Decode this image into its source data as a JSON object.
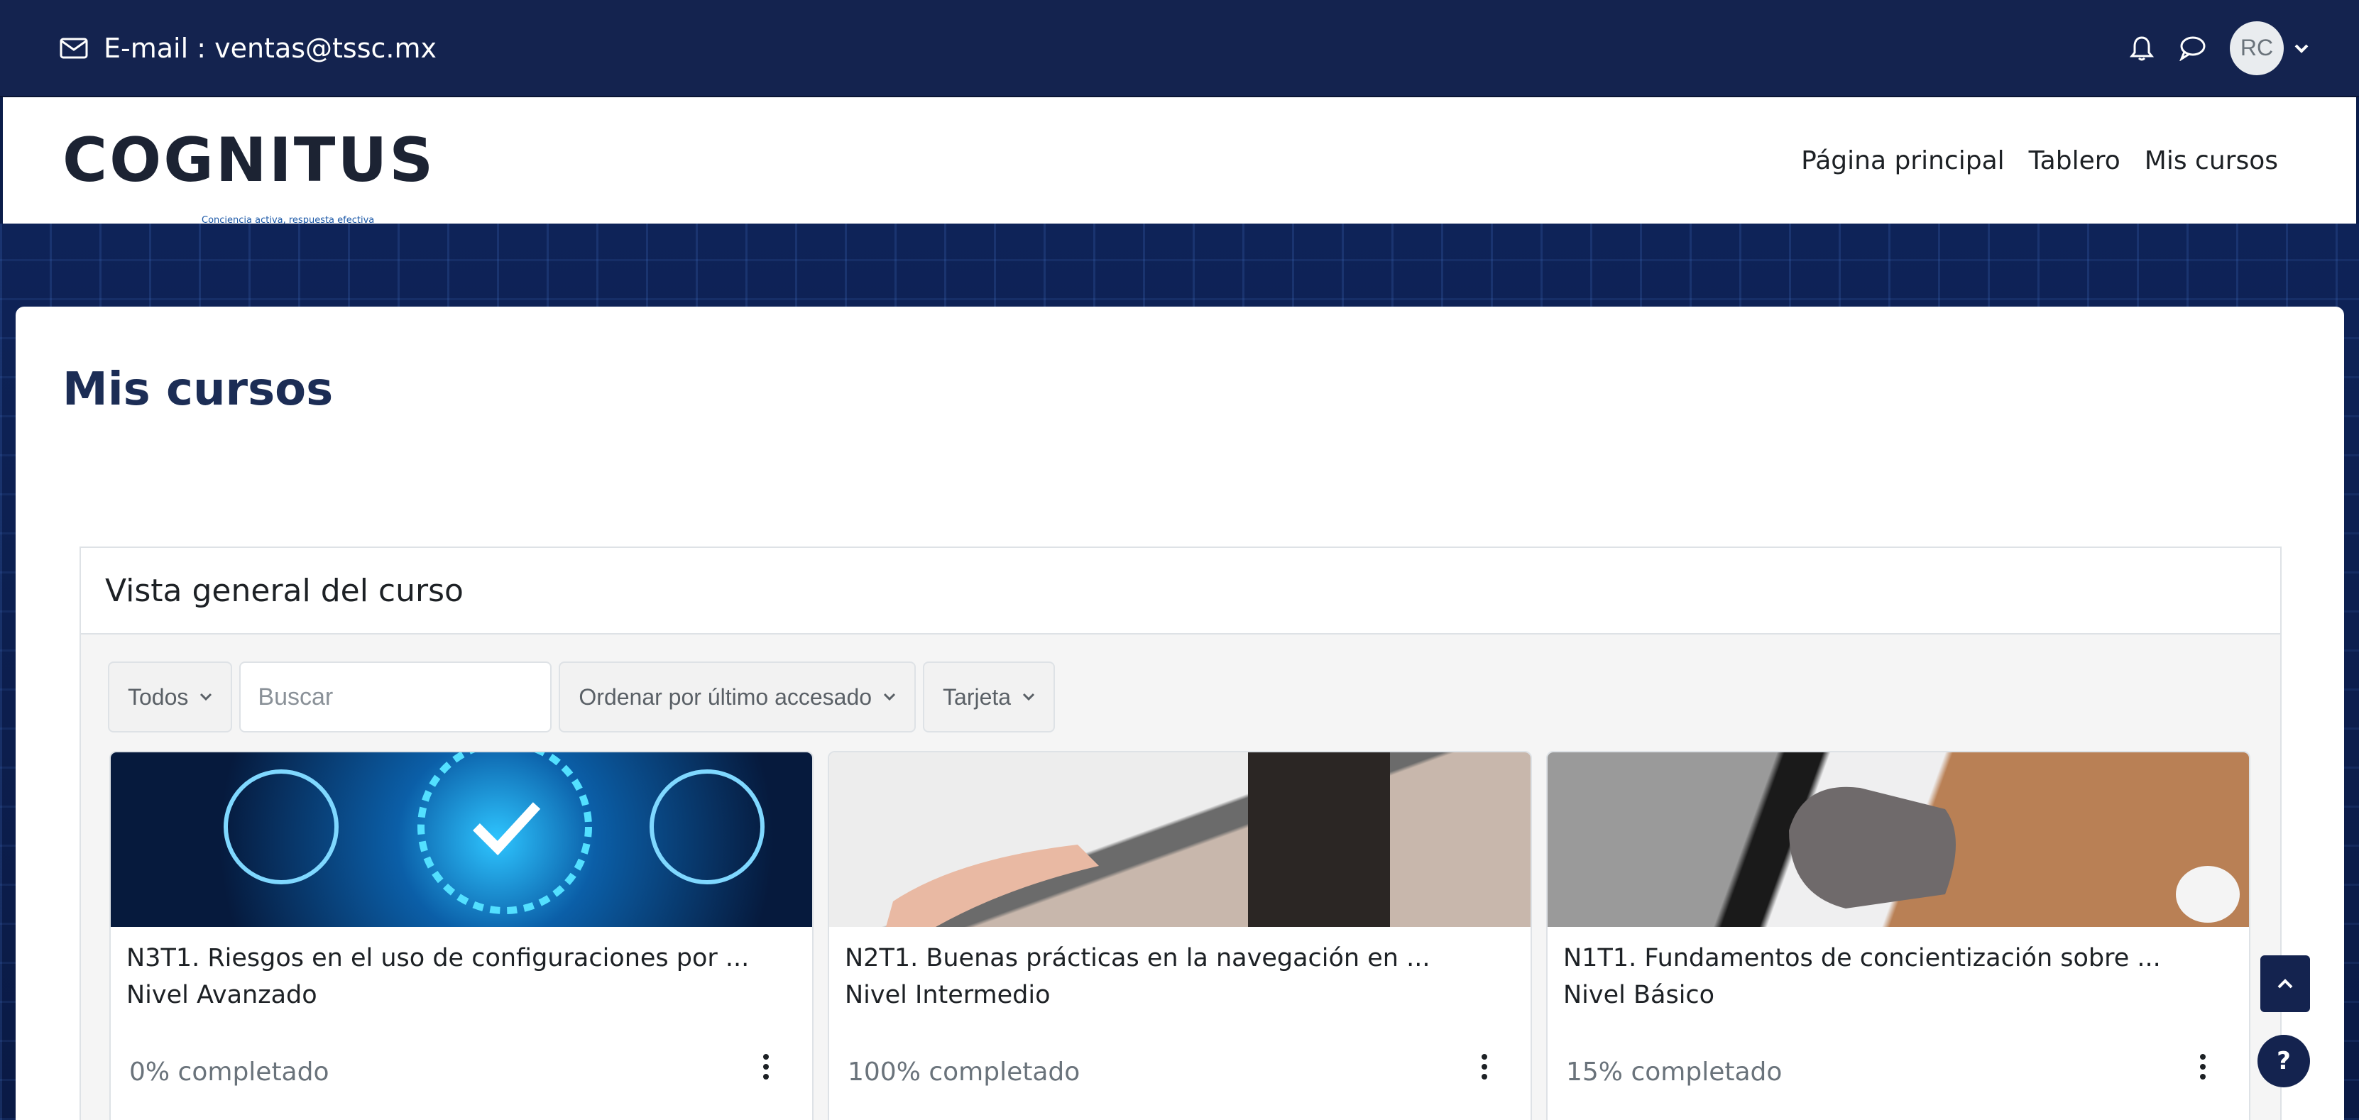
{
  "topbar": {
    "email_text": "E-mail : ventas@tssc.mx",
    "user_initials": "RC"
  },
  "navbar": {
    "logo_text": "COGNITUS",
    "logo_tagline": "Conciencia activa, respuesta efectiva",
    "links": [
      "Página principal",
      "Tablero",
      "Mis cursos"
    ]
  },
  "page": {
    "title": "Mis cursos"
  },
  "overview": {
    "header": "Vista general del curso",
    "filter_all": "Todos",
    "search_placeholder": "Buscar",
    "sort_label": "Ordenar por último accesado",
    "view_label": "Tarjeta"
  },
  "courses": [
    {
      "title": "N3T1. Riesgos en el uso de configuraciones por ...",
      "level": "Nivel Avanzado",
      "progress": "0% completado",
      "progress_value": 0
    },
    {
      "title": "N2T1. Buenas prácticas en la navegación en ...",
      "level": "Nivel Intermedio",
      "progress": "100% completado",
      "progress_value": 100
    },
    {
      "title": "N1T1. Fundamentos de concientización sobre ...",
      "level": "Nivel Básico",
      "progress": "15% completado",
      "progress_value": 15
    }
  ],
  "floating": {
    "help_label": "?"
  },
  "colors": {
    "primary_navy": "#14234f",
    "title_color": "#1c2d55",
    "logo_accent": "#1e5aa8"
  },
  "icons": [
    "envelope-icon",
    "bell-icon",
    "chat-icon",
    "chevron-down-icon",
    "chevron-up-icon",
    "kebab-menu-icon",
    "question-icon",
    "shield-code-icon"
  ]
}
